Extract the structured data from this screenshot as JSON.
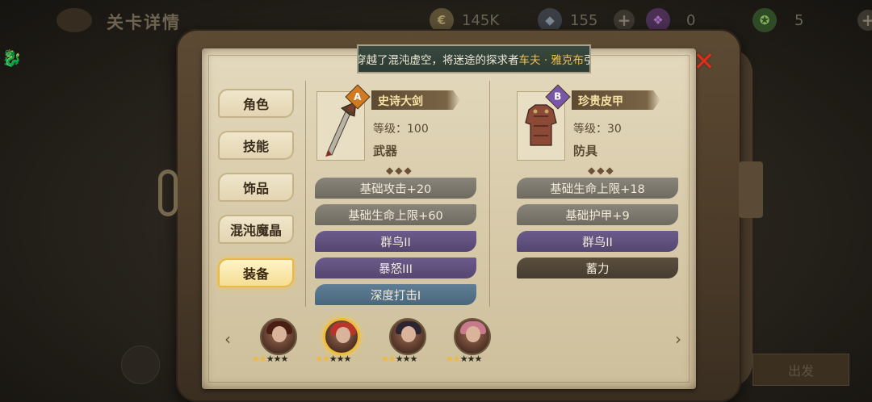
{
  "background": {
    "title": "关卡详情",
    "resources": [
      {
        "name": "gold",
        "icon": "coin-icon",
        "value": "145K",
        "color": "#8a7a4a"
      },
      {
        "name": "diamond",
        "icon": "diamond-icon",
        "value": "155",
        "color": "#6f7a86"
      },
      {
        "name": "ticket",
        "icon": "purple-ticket-icon",
        "value": "0",
        "color": "#7a4d8c"
      },
      {
        "name": "stamina",
        "icon": "green-orb-icon",
        "value": "5",
        "color": "#4d7a3a"
      }
    ],
    "plus_label": "+",
    "start_button": "出发"
  },
  "banner": {
    "prefix": "!",
    "text": "穿越了混沌虚空，将迷途的探求者",
    "highlight": "车夫 · 雅克布",
    "suffix": "引'"
  },
  "close_label": "✕",
  "tabs": [
    {
      "label": "角色",
      "active": false
    },
    {
      "label": "技能",
      "active": false
    },
    {
      "label": "饰品",
      "active": false
    },
    {
      "label": "混沌魔晶",
      "active": false
    },
    {
      "label": "装备",
      "active": true
    }
  ],
  "weapon": {
    "grade": "A",
    "grade_color": "#d07a22",
    "name": "史诗大剑",
    "level": "等级：100",
    "type": "武器",
    "stats": [
      {
        "text": "基础攻击+20",
        "style": "gray"
      },
      {
        "text": "基础生命上限+60",
        "style": "gray"
      },
      {
        "text": "群鸟II",
        "style": "purple"
      },
      {
        "text": "暴怒III",
        "style": "purple"
      },
      {
        "text": "深度打击I",
        "style": "blue"
      }
    ]
  },
  "armor": {
    "grade": "B",
    "grade_color": "#7a56a8",
    "name": "珍贵皮甲",
    "level": "等级：30",
    "type": "防具",
    "stats": [
      {
        "text": "基础生命上限+18",
        "style": "gray"
      },
      {
        "text": "基础护甲+9",
        "style": "gray"
      },
      {
        "text": "群鸟II",
        "style": "purple"
      },
      {
        "text": "蓄力",
        "style": "dark"
      }
    ]
  },
  "ornament": "◆◆◆",
  "heroes": [
    {
      "name": "hero-1",
      "stars": 2,
      "selected": false,
      "hair": "#4a1e12"
    },
    {
      "name": "hero-2",
      "stars": 2,
      "selected": true,
      "hair": "#b8352a"
    },
    {
      "name": "hero-3",
      "stars": 2,
      "selected": false,
      "hair": "#2a2530"
    },
    {
      "name": "hero-4",
      "stars": 2,
      "selected": false,
      "hair": "#c87a8c"
    }
  ],
  "max_stars": 5,
  "arrows": {
    "left": "‹",
    "right": "›"
  }
}
